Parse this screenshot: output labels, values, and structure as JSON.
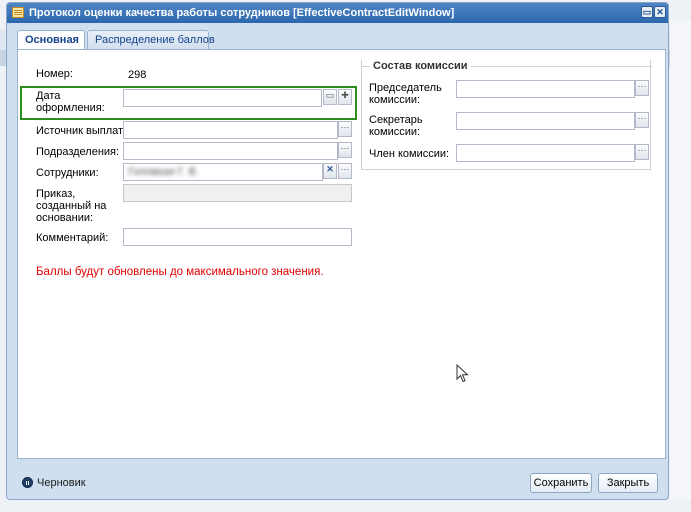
{
  "window": {
    "title": "Протокол оценки качества работы сотрудников [EffectiveContractEditWindow]"
  },
  "tabs": [
    {
      "label": "Основная"
    },
    {
      "label": "Распределение баллов"
    }
  ],
  "form": {
    "number_label": "Номер:",
    "number_value": "298",
    "date_label_line1": "Дата",
    "date_label_line2": "оформления:",
    "date_value": "",
    "source_label": "Источник выплат:",
    "source_value": "",
    "division_label": "Подразделения:",
    "division_value": "",
    "employees_label": "Сотрудники:",
    "employees_value": "Головкая Г. В.",
    "order_label_line1": "Приказ,",
    "order_label_line2": "созданный на",
    "order_label_line3": "основании:",
    "order_value": "",
    "comment_label": "Комментарий:",
    "comment_value": "",
    "warning": "Баллы будут обновлены до максимального значения."
  },
  "commission": {
    "legend": "Состав комиссии",
    "chair_label_line1": "Председатель",
    "chair_label_line2": "комиссии:",
    "chair_value": "",
    "secretary_label_line1": "Секретарь",
    "secretary_label_line2": "комиссии:",
    "secretary_value": "",
    "member_label": "Член комиссии:",
    "member_value": ""
  },
  "footer": {
    "status": "Черновик",
    "save_label": "Сохранить",
    "close_label": "Закрыть"
  },
  "icons": {
    "window": "document-icon",
    "minimize": "minimize-icon",
    "close": "close-icon",
    "calendar": "calendar-icon",
    "select": "ellipsis-icon",
    "clear": "clear-icon",
    "status": "pause-icon",
    "cursor": "mouse-cursor-icon"
  },
  "colors": {
    "titlebar": "#2c66ad",
    "warning": "#e00000",
    "highlight": "#2e8b1e"
  }
}
